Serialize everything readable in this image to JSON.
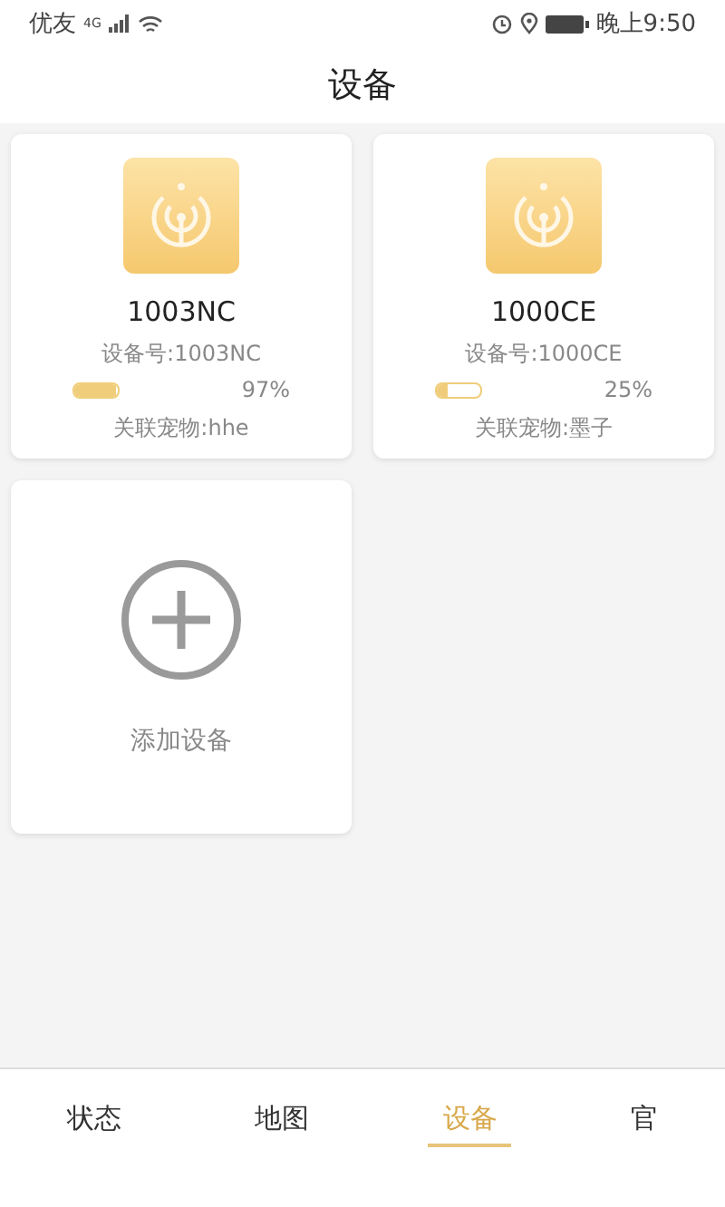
{
  "status_bar": {
    "carrier": "优友",
    "network": "4G",
    "time": "晚上9:50"
  },
  "title": "设备",
  "devices": [
    {
      "name": "1003NC",
      "number": "设备号:1003NC",
      "level": 0.97,
      "battery": "97%",
      "pet": "关联宠物:hhe"
    },
    {
      "name": "1000CE",
      "number": "设备号:1000CE",
      "level": 0.25,
      "battery": "25%",
      "pet": "关联宠物:墨子"
    }
  ],
  "add_device": {
    "label": "添加设备"
  },
  "tabs": [
    {
      "label": "状态",
      "selected": false
    },
    {
      "label": "地图",
      "selected": false
    },
    {
      "label": "设备",
      "selected": true
    },
    {
      "label": "官",
      "selected": false
    }
  ]
}
